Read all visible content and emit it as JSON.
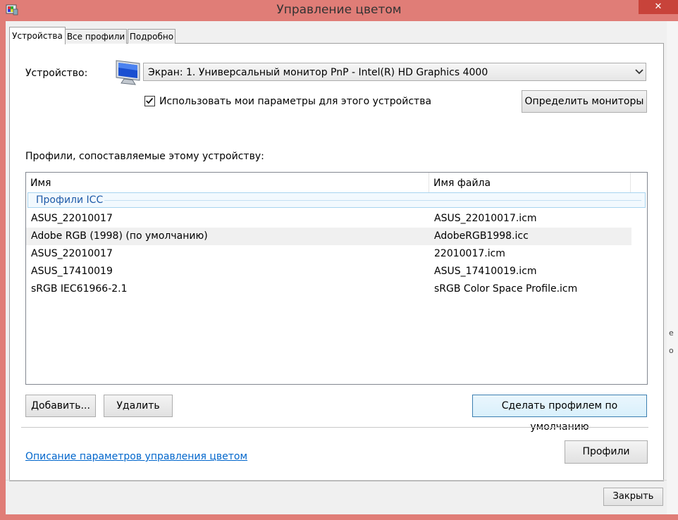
{
  "window": {
    "title": "Управление цветом",
    "close_glyph": "✕",
    "colors": {
      "titlebar": "#e07d77",
      "close": "#c8433a",
      "accent": "#0066cc"
    }
  },
  "tabs": [
    {
      "label": "Устройства",
      "active": true
    },
    {
      "label": "Все профили",
      "active": false
    },
    {
      "label": "Подробно",
      "active": false
    }
  ],
  "device": {
    "label": "Устройство:",
    "selected": "Экран: 1. Универсальный монитор PnP - Intel(R) HD Graphics 4000",
    "icon": "monitor-icon",
    "use_settings_label": "Использовать мои параметры для этого устройства",
    "use_settings_checked": true,
    "identify_button": "Определить мониторы"
  },
  "profiles": {
    "label": "Профили, сопоставляемые этому устройству:",
    "columns": [
      "Имя",
      "Имя файла"
    ],
    "group": "Профили ICC",
    "rows": [
      {
        "name": "ASUS_22010017",
        "file": "ASUS_22010017.icm"
      },
      {
        "name": "Adobe RGB (1998) (по умолчанию)",
        "file": "AdobeRGB1998.icc"
      },
      {
        "name": "ASUS_22010017",
        "file": "22010017.icm"
      },
      {
        "name": "ASUS_17410019",
        "file": "ASUS_17410019.icm"
      },
      {
        "name": "sRGB IEC61966-2.1",
        "file": "sRGB Color Space Profile.icm"
      }
    ],
    "highlighted_row": 1
  },
  "buttons": {
    "add": "Добавить...",
    "remove": "Удалить",
    "set_default": "Сделать профилем по умолчанию",
    "profiles": "Профили",
    "close": "Закрыть"
  },
  "link": "Описание параметров управления цветом",
  "right_edge_marks": [
    "е",
    "о"
  ]
}
